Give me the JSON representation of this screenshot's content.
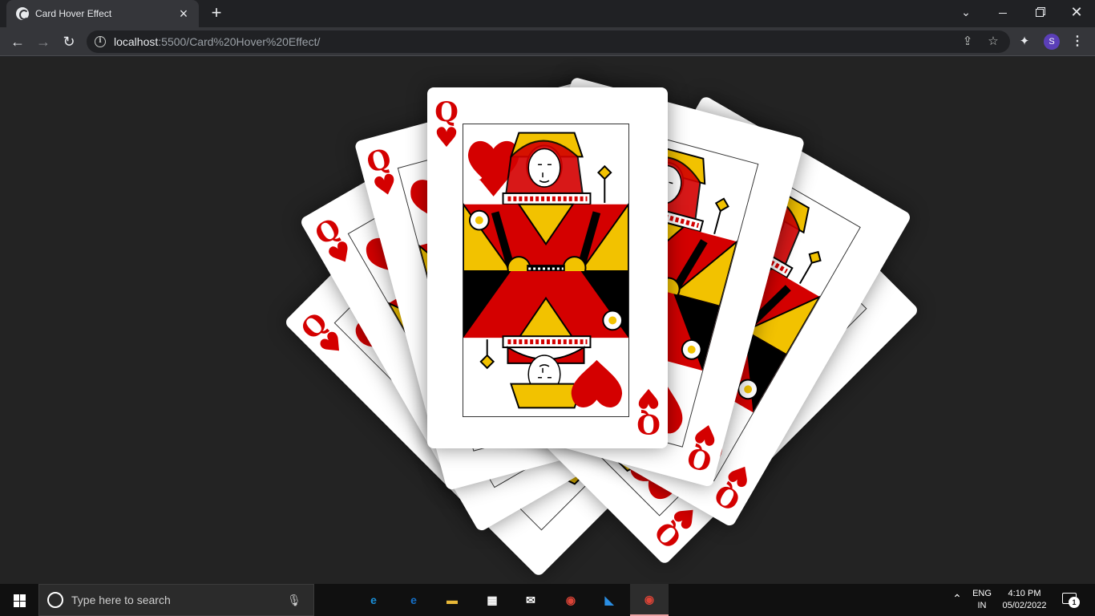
{
  "browser": {
    "tab_title": "Card Hover Effect",
    "new_tab_symbol": "+",
    "url_host": "localhost",
    "url_rest": ":5500/Card%20Hover%20Effect/",
    "profile_initial": "S"
  },
  "page": {
    "background": "#232323",
    "card": {
      "rank": "Q",
      "suit": "♥",
      "suit_color": "#d40000",
      "count": 7
    }
  },
  "taskbar": {
    "search_placeholder": "Type here to search",
    "apps": [
      {
        "name": "task-view",
        "glyph": "▭",
        "color": "#101010"
      },
      {
        "name": "edge",
        "glyph": "e",
        "color": "#1a8fd8"
      },
      {
        "name": "ie",
        "glyph": "e",
        "color": "#1570c9"
      },
      {
        "name": "file-explorer",
        "glyph": "▬",
        "color": "#e8b838"
      },
      {
        "name": "store",
        "glyph": "▦",
        "color": "#ffffff"
      },
      {
        "name": "mail",
        "glyph": "✉",
        "color": "#ffffff"
      },
      {
        "name": "chrome",
        "glyph": "◉",
        "color": "#db4437"
      },
      {
        "name": "vscode",
        "glyph": "◣",
        "color": "#2a8ee3"
      },
      {
        "name": "chrome-profile",
        "glyph": "◉",
        "color": "#db4437"
      }
    ],
    "lang_line1": "ENG",
    "lang_line2": "IN",
    "time": "4:10 PM",
    "date": "05/02/2022",
    "notification_count": "1"
  }
}
